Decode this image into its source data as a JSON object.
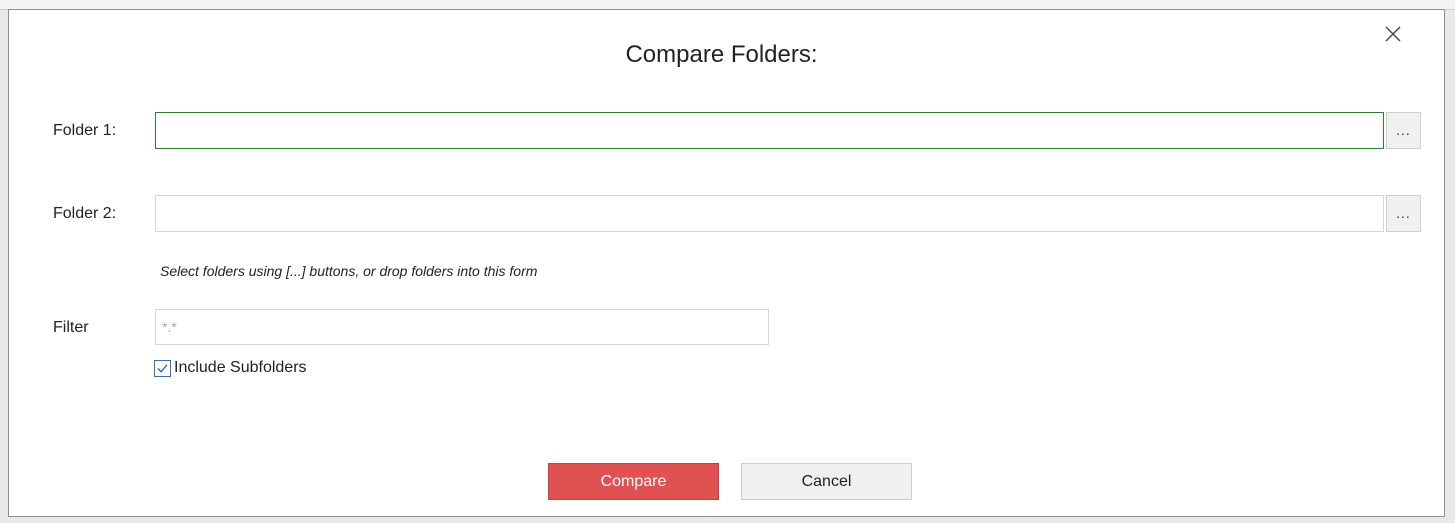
{
  "dialog": {
    "title": "Compare Folders:",
    "close_icon": "close-icon"
  },
  "folder1": {
    "label": "Folder 1:",
    "value": "",
    "browse_label": "..."
  },
  "folder2": {
    "label": "Folder 2:",
    "value": "",
    "browse_label": "..."
  },
  "hint": "Select folders using [...] buttons, or drop folders into this form",
  "filter": {
    "label": "Filter",
    "value": "",
    "placeholder": "*.*"
  },
  "include_subfolders": {
    "label": "Include Subfolders",
    "checked": true
  },
  "buttons": {
    "compare": "Compare",
    "cancel": "Cancel"
  },
  "colors": {
    "accent": "#e05252",
    "focus_border": "#2e7d32",
    "checkbox_border": "#3b6fb5"
  }
}
